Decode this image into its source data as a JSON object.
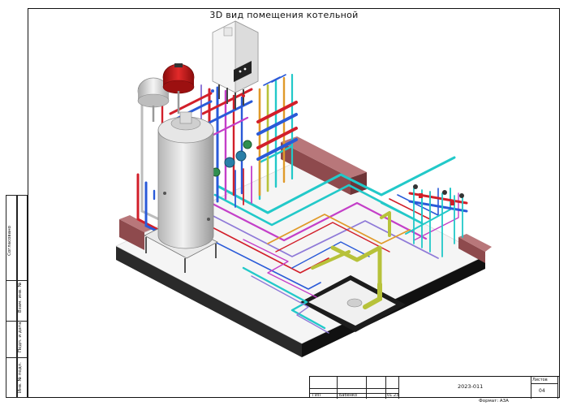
{
  "drawing": {
    "title": "3D вид помещения котельной",
    "format_label": "Формат: А3А"
  },
  "side_strip": {
    "agreed": "Согласовано",
    "replaced_inv": "Взам. инв. №",
    "signature_date": "Подп. и дата",
    "inv_original": "Инв. № подл."
  },
  "stamp": {
    "row_label": "ГИП",
    "name": "Бабенко",
    "date": "01.23",
    "code": "2023-011",
    "sheets_label": "Листов",
    "sheets_value": "04"
  },
  "colors": {
    "floor_top": "#f4f4f4",
    "slab_side": "#222222",
    "wall_brick": "#a45c5f",
    "pipe_red": "#d21f2a",
    "pipe_blue": "#2a5ad8",
    "pipe_cyan": "#22c9c9",
    "pipe_magenta": "#c43fc8",
    "pipe_orange": "#e09a2a",
    "pipe_olive": "#b7c23a",
    "pipe_violet": "#8f7ad8",
    "tank": "#dcdcdc",
    "expansion_red": "#d81818"
  }
}
